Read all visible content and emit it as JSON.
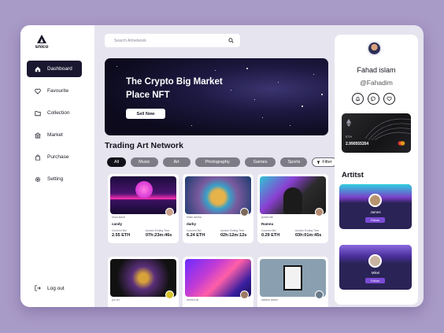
{
  "app": {
    "logo_text": "snico"
  },
  "sidebar": {
    "items": [
      {
        "label": "Dashboard",
        "icon": "home-icon",
        "active": true
      },
      {
        "label": "Favourite",
        "icon": "heart-icon"
      },
      {
        "label": "Collection",
        "icon": "folder-icon"
      },
      {
        "label": "Market",
        "icon": "market-icon"
      },
      {
        "label": "Purchase",
        "icon": "bag-icon"
      },
      {
        "label": "Setting",
        "icon": "gear-icon"
      }
    ],
    "logout": "Log out"
  },
  "search": {
    "placeholder": "Search Artnetwork"
  },
  "banner": {
    "title": "The Crypto Big Market Place NFT",
    "button": "Sell Now"
  },
  "section": {
    "title": "Trading Art Network"
  },
  "filters": [
    "All",
    "Music",
    "Art",
    "Photography",
    "Games",
    "Sports"
  ],
  "filter_button": "Filter",
  "cards": [
    {
      "owner": "erica alone",
      "name": "candy",
      "bid_label": "Courrent Bid",
      "time_label": "Auction Ending Time",
      "bid": "2.55 ETH",
      "time": "07h:23m:46s"
    },
    {
      "owner": "Mitch anima",
      "name": "darky",
      "bid_label": "Courrent Bid",
      "time_label": "Auction Ending Time",
      "bid": "6.24 ETH",
      "time": "02h:12m:12s"
    },
    {
      "owner": "james lite",
      "name": "Ramnu",
      "bid_label": "Courrent Bid",
      "time_label": "Auction Ending Time",
      "bid": "0.29 ETH",
      "time": "03h:01m:45s"
    }
  ],
  "cards_row2": [
    {
      "owner": "jon arr"
    },
    {
      "owner": "ahmed ali"
    },
    {
      "owner": "watson adam"
    }
  ],
  "profile": {
    "name": "Fahad islam",
    "handle": "@Fahadim",
    "icons": [
      "bell-icon",
      "chat-icon",
      "heart-icon"
    ]
  },
  "wallet": {
    "currency_label": "ETH",
    "balance": "2.990555354"
  },
  "artists": {
    "title": "Artitst",
    "items": [
      {
        "name": "James",
        "follow": "Follow"
      },
      {
        "name": "Mikel",
        "follow": "Follow"
      }
    ]
  },
  "colors": {
    "accent": "#7b4bd6",
    "dark": "#1a1830",
    "bg": "#a99bc8"
  }
}
